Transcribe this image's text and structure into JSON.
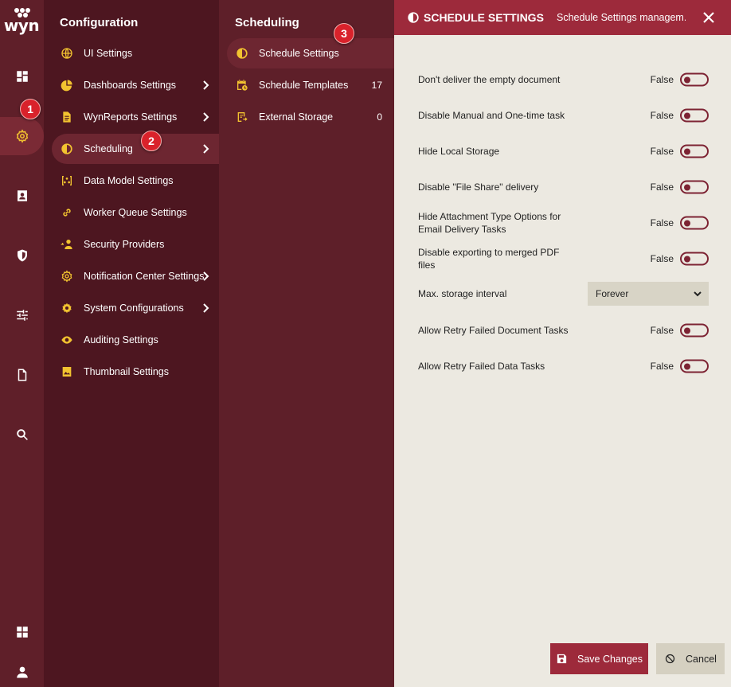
{
  "logo": {
    "text": "wyn"
  },
  "rail": {
    "items": [
      "dashboards-icon",
      "gear-icon",
      "contacts-icon",
      "shield-icon",
      "sliders-icon",
      "document-icon",
      "search-icon",
      "apps-icon",
      "user-icon"
    ]
  },
  "badges": [
    "1",
    "2",
    "3"
  ],
  "config": {
    "title": "Configuration",
    "items": [
      {
        "label": "UI Settings",
        "icon": "globe-icon"
      },
      {
        "label": "Dashboards Settings",
        "icon": "pie-chart-icon"
      },
      {
        "label": "WynReports Settings",
        "icon": "report-icon"
      },
      {
        "label": "Scheduling",
        "icon": "clock-icon"
      },
      {
        "label": "Data Model Settings",
        "icon": "data-model-icon"
      },
      {
        "label": "Worker Queue Settings",
        "icon": "link-icon"
      },
      {
        "label": "Security Providers",
        "icon": "user-key-icon"
      },
      {
        "label": "Notification Center Settings",
        "icon": "gear-icon"
      },
      {
        "label": "System Configurations",
        "icon": "gear-icon"
      },
      {
        "label": "Auditing Settings",
        "icon": "eye-icon"
      },
      {
        "label": "Thumbnail Settings",
        "icon": "image-icon"
      }
    ]
  },
  "scheduling": {
    "title": "Scheduling",
    "items": [
      {
        "label": "Schedule Settings",
        "count": ""
      },
      {
        "label": "Schedule Templates",
        "count": "17"
      },
      {
        "label": "External Storage",
        "count": "0"
      }
    ]
  },
  "settings": {
    "title": "SCHEDULE SETTINGS",
    "subtitle": "Schedule Settings managem...",
    "rows": [
      {
        "label": "Don't deliver the empty document",
        "value": "False"
      },
      {
        "label": "Disable Manual and One-time task",
        "value": "False"
      },
      {
        "label": "Hide Local Storage",
        "value": "False"
      },
      {
        "label": "Disable \"File Share\" delivery",
        "value": "False"
      },
      {
        "label": "Hide Attachment Type Options for Email Delivery Tasks",
        "value": "False"
      },
      {
        "label": "Disable exporting to merged PDF files",
        "value": "False"
      },
      {
        "label": "Max. storage interval",
        "value": "Forever"
      },
      {
        "label": "Allow Retry Failed Document Tasks",
        "value": "False"
      },
      {
        "label": "Allow Retry Failed Data Tasks",
        "value": "False"
      }
    ],
    "save_label": "Save Changes",
    "cancel_label": "Cancel"
  },
  "colors": {
    "accent": "#9d2a3b",
    "icon_yellow": "#f2c330",
    "rail": "#5f1f29",
    "panel": "#4d1620"
  }
}
